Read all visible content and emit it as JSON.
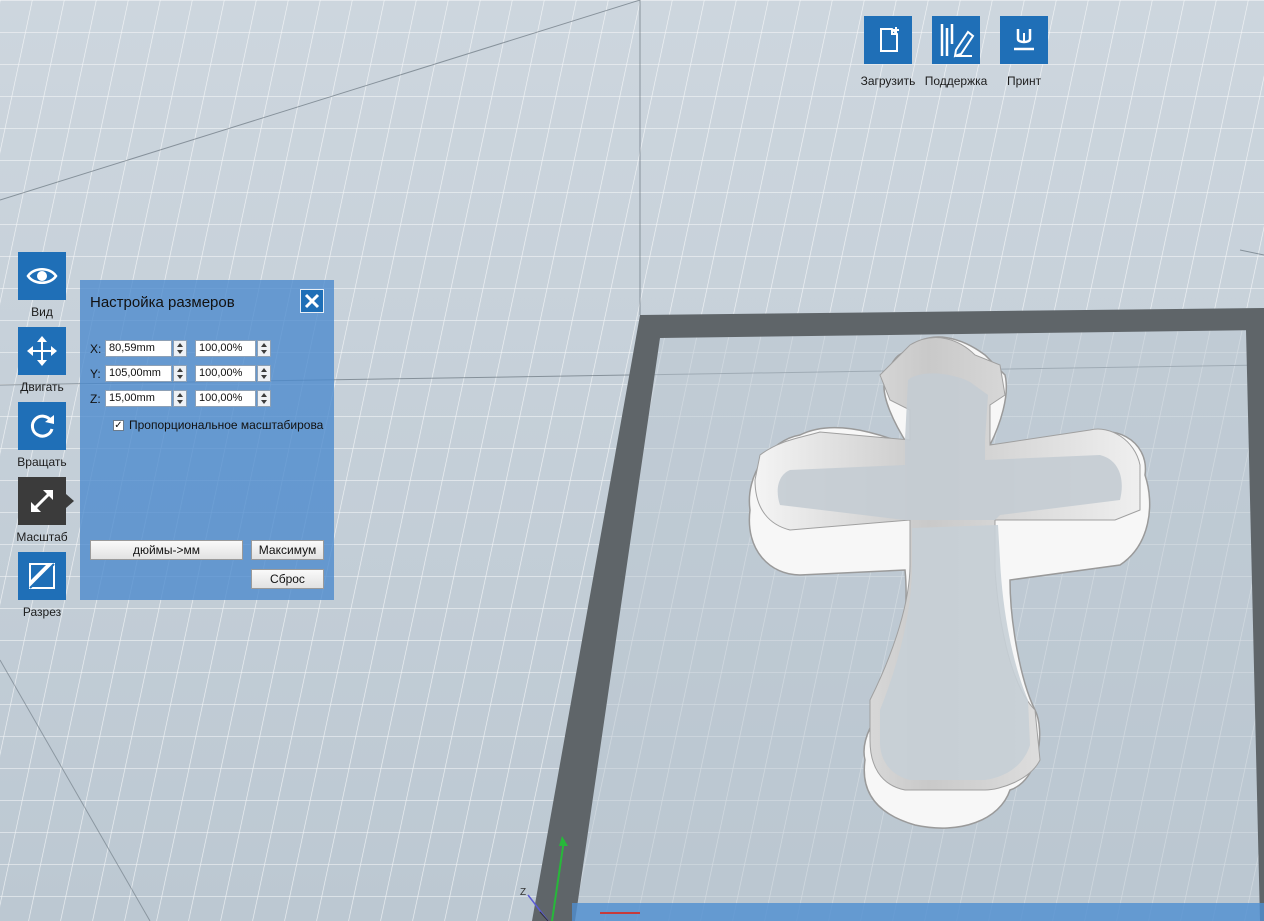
{
  "toolbar": {
    "load_label": "Загрузить",
    "support_label": "Поддержка",
    "print_label": "Принт"
  },
  "tools": {
    "view_label": "Вид",
    "move_label": "Двигать",
    "rotate_label": "Вращать",
    "scale_label": "Масштаб",
    "cut_label": "Разрез",
    "active": "scale"
  },
  "scale_panel": {
    "title": "Настройка размеров",
    "x_label": "X:",
    "y_label": "Y:",
    "z_label": "Z:",
    "x_mm": "80,59mm",
    "y_mm": "105,00mm",
    "z_mm": "15,00mm",
    "x_pct": "100,00%",
    "y_pct": "100,00%",
    "z_pct": "100,00%",
    "proportional_checked": true,
    "proportional_label": "Пропорциональное масштабирова",
    "inch_to_mm_label": "дюймы->мм",
    "max_label": "Максимум",
    "reset_label": "Сброс"
  },
  "gizmo": {
    "z_label": "Z"
  },
  "colors": {
    "accent": "#1f6fb7",
    "active_tool": "#3b3b3b",
    "panel": "#4a89cd",
    "plate_border": "#5f6569",
    "model": "#e8e8e8"
  }
}
